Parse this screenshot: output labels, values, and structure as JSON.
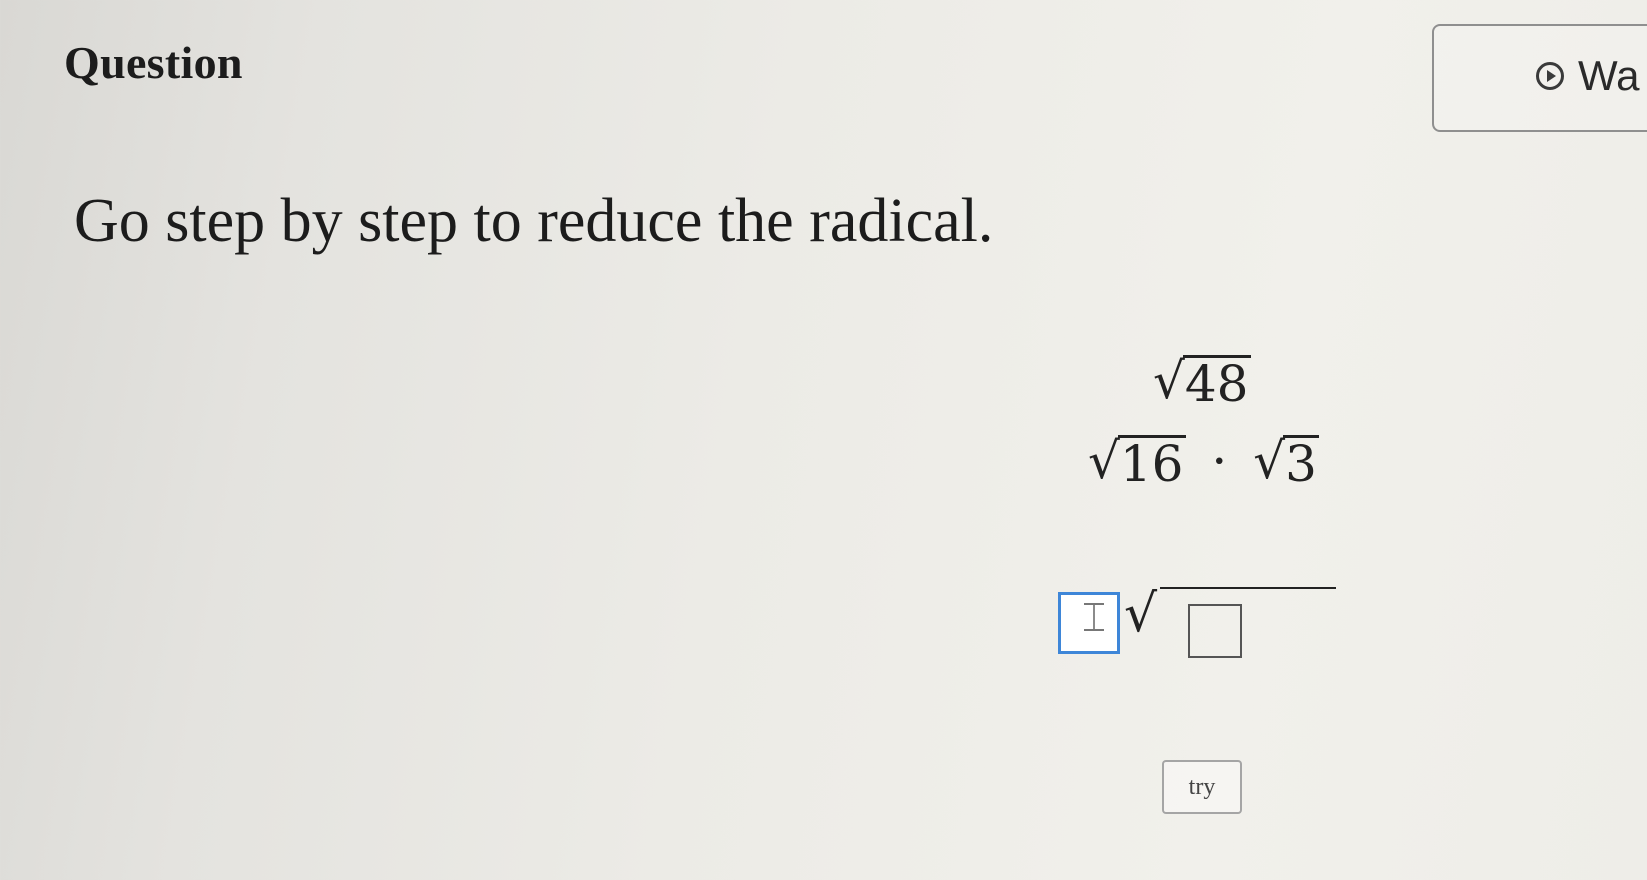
{
  "header": {
    "title": "Question",
    "video_label": "Wa",
    "video_icon": "play-circle-icon"
  },
  "instruction": "Go step by step to reduce the radical.",
  "steps": [
    {
      "radicand": "48"
    },
    {
      "left_radicand": "16",
      "operator": "·",
      "right_radicand": "3"
    }
  ],
  "answer": {
    "coefficient_value": "",
    "radicand_value": "",
    "radical_symbol": "√"
  },
  "try_button": {
    "label": "try"
  },
  "colors": {
    "focus_border": "#3e86d8"
  }
}
